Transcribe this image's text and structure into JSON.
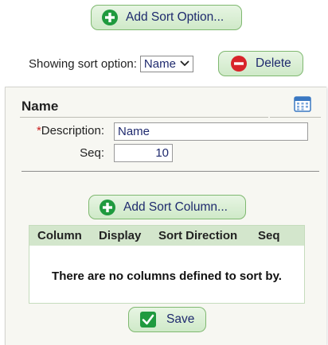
{
  "toolbar": {
    "add_sort_option_label": "Add Sort Option...",
    "add_icon": "plus-circle-icon",
    "showing_label": "Showing sort option:",
    "selected_sort_option": "Name",
    "delete_label": "Delete",
    "delete_icon": "minus-circle-icon"
  },
  "panel": {
    "title": "Name",
    "calendar_icon": "calendar-icon",
    "fields": {
      "description_required_marker": "*",
      "description_label": "Description:",
      "description_value": "Name",
      "seq_label": "Seq:",
      "seq_value": "10"
    },
    "add_sort_column_label": "Add Sort Column...",
    "table": {
      "columns": [
        "Column",
        "Display",
        "Sort Direction",
        "Seq"
      ],
      "empty_message": "There are no columns defined to sort by."
    },
    "save_label": "Save",
    "save_icon": "checkmark-icon"
  },
  "colors": {
    "button_green_top": "#e7f5e3",
    "button_green_bottom": "#cfe9c8",
    "icon_green": "#1f9a3e",
    "icon_red": "#d8232a",
    "text_blue": "#1f2a6e",
    "table_header": "#d3e6cc"
  }
}
